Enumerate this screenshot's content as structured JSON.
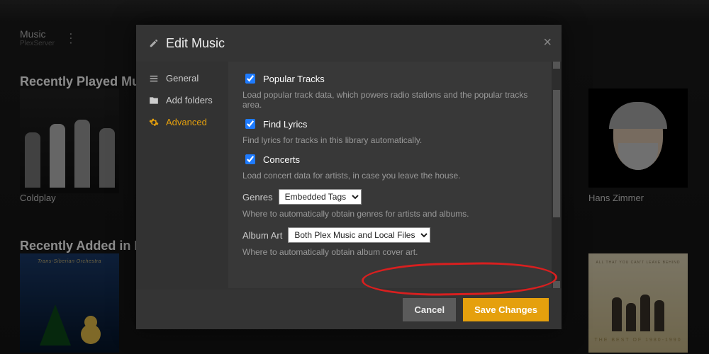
{
  "library": {
    "title": "Music",
    "server": "PlexServer"
  },
  "sections": {
    "recent_played": "Recently Played Music",
    "recent_added": "Recently Added in Music"
  },
  "cards": {
    "coldplay": "Coldplay",
    "hans": "Hans Zimmer"
  },
  "album5": {
    "top": "ALL THAT YOU CAN'T LEAVE BEHIND",
    "bottom": "THE BEST OF 1980-1990"
  },
  "modal": {
    "title": "Edit Music",
    "close": "×",
    "side": {
      "general": "General",
      "folders": "Add folders",
      "advanced": "Advanced"
    },
    "popular": {
      "label": "Popular Tracks",
      "help": "Load popular track data, which powers radio stations and the popular tracks area."
    },
    "lyrics": {
      "label": "Find Lyrics",
      "help": "Find lyrics for tracks in this library automatically."
    },
    "concerts": {
      "label": "Concerts",
      "help": "Load concert data for artists, in case you leave the house."
    },
    "genres": {
      "label": "Genres",
      "value": "Embedded Tags",
      "help": "Where to automatically obtain genres for artists and albums."
    },
    "art": {
      "label": "Album Art",
      "value": "Both Plex Music and Local Files",
      "help": "Where to automatically obtain album cover art."
    },
    "cancel": "Cancel",
    "save": "Save Changes"
  }
}
